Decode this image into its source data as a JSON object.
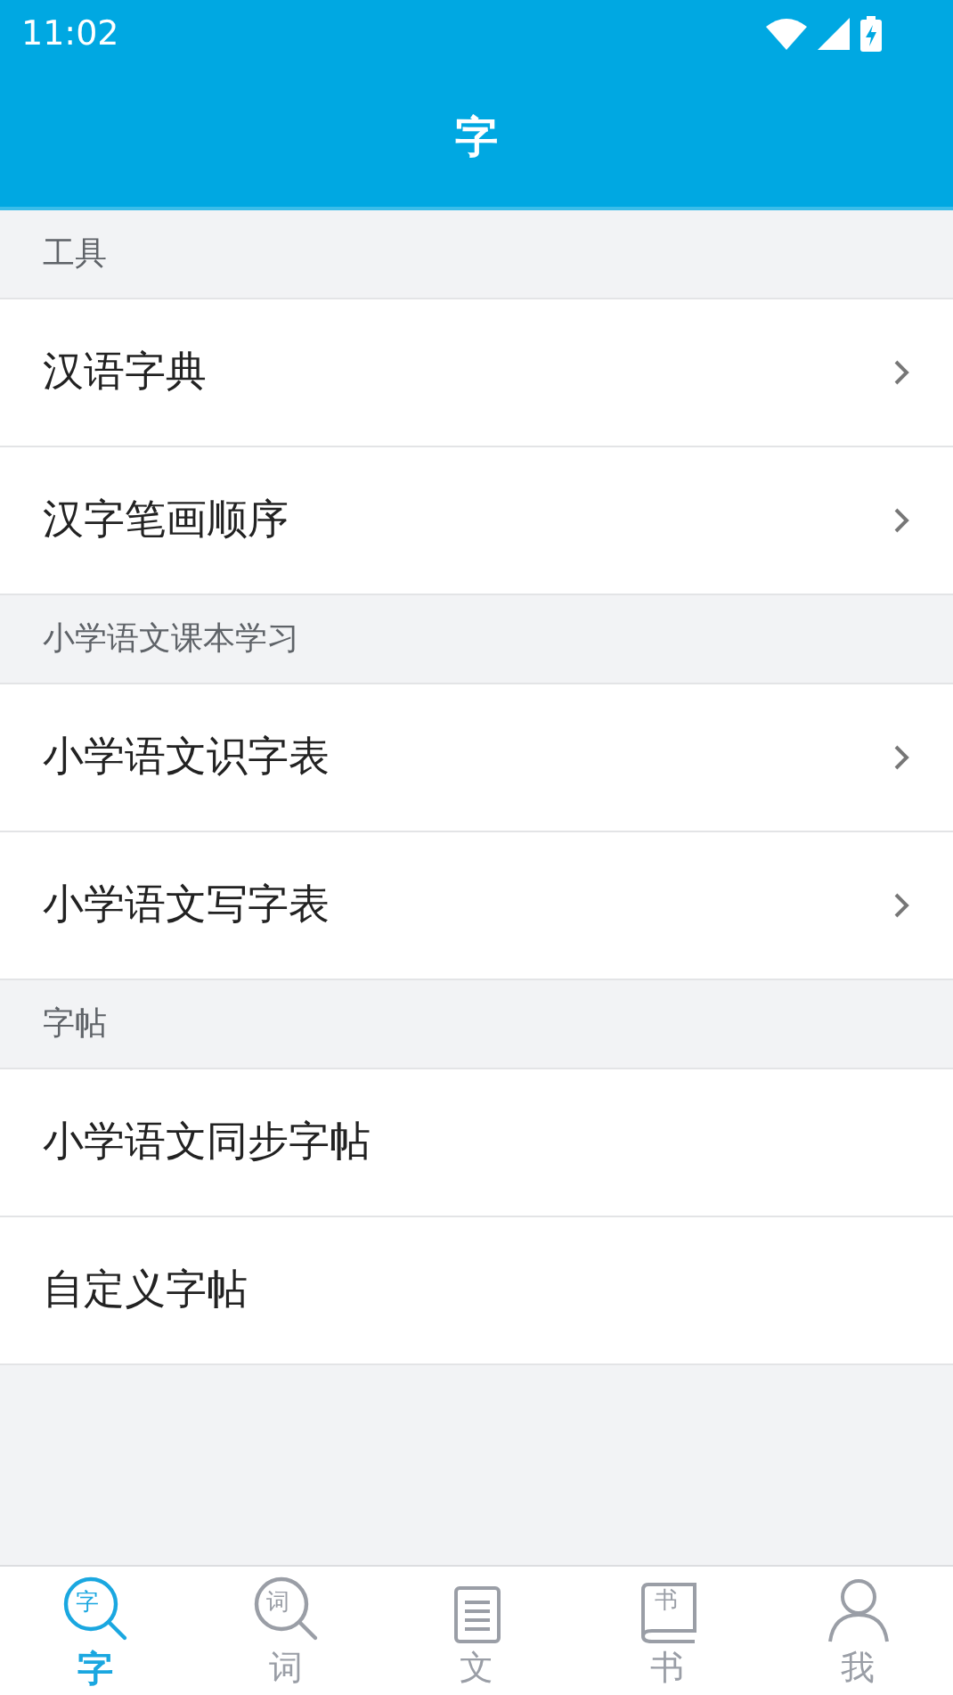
{
  "status_bar": {
    "time": "11:02"
  },
  "header": {
    "title": "字"
  },
  "sections": [
    {
      "title": "工具",
      "items": [
        {
          "label": "汉语字典",
          "chevron": true
        },
        {
          "label": "汉字笔画顺序",
          "chevron": true
        }
      ]
    },
    {
      "title": "小学语文课本学习",
      "items": [
        {
          "label": "小学语文识字表",
          "chevron": true
        },
        {
          "label": "小学语文写字表",
          "chevron": true
        }
      ]
    },
    {
      "title": "字帖",
      "items": [
        {
          "label": "小学语文同步字帖",
          "chevron": false
        },
        {
          "label": "自定义字帖",
          "chevron": false
        }
      ]
    }
  ],
  "tabs": [
    {
      "label": "字",
      "kind": "magnifier",
      "icon_text": "字",
      "selected": true
    },
    {
      "label": "词",
      "kind": "magnifier",
      "icon_text": "词",
      "selected": false
    },
    {
      "label": "文",
      "kind": "document",
      "selected": false
    },
    {
      "label": "书",
      "kind": "book",
      "icon_text": "书",
      "selected": false
    },
    {
      "label": "我",
      "kind": "person",
      "selected": false
    }
  ]
}
